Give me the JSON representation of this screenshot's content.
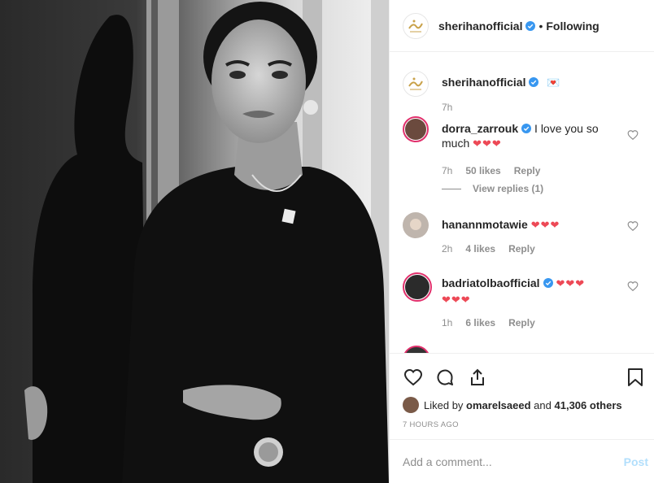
{
  "post": {
    "author": "sherihanofficial",
    "dot": "•",
    "follow_status": "Following",
    "caption_emoji": "💌",
    "caption_time": "7h"
  },
  "comments": [
    {
      "user": "dorra_zarrouk",
      "text": "I love you so",
      "text2": "much",
      "hearts": "❤❤❤",
      "time": "7h",
      "likes": "50 likes",
      "reply": "Reply",
      "view_replies": "View replies (1)"
    },
    {
      "user": "hanannmotawie",
      "hearts": "❤❤❤",
      "time": "2h",
      "likes": "4 likes",
      "reply": "Reply"
    },
    {
      "user": "badriatolbaofficial",
      "hearts": "❤❤❤",
      "hearts2": "❤❤❤",
      "time": "1h",
      "likes": "6 likes",
      "reply": "Reply"
    }
  ],
  "likes": {
    "prefix": "Liked by",
    "first_user": "omarelsaeed",
    "and": "and",
    "others": "41,306 others"
  },
  "timestamp": "7 HOURS AGO",
  "add_comment": {
    "placeholder": "Add a comment...",
    "post_label": "Post"
  },
  "colors": {
    "verified": "#3897f0",
    "heart": "#ed4956",
    "post_disabled": "#b2dffc",
    "muted": "#8e8e8e",
    "logo_gold": "#c9a24a"
  }
}
